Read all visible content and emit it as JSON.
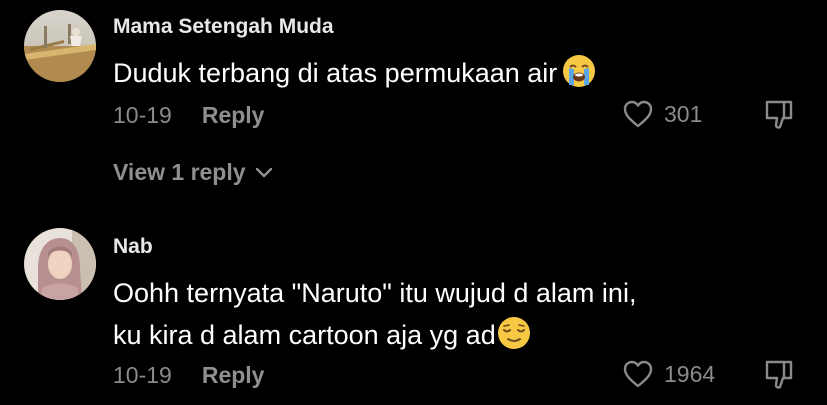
{
  "comments": [
    {
      "username": "Mama Setengah Muda",
      "text_lines": [
        "Duduk terbang di atas permukaan air"
      ],
      "emoji": "loudly-crying-face",
      "date": "10-19",
      "reply_label": "Reply",
      "like_count": "301",
      "view_replies_label": "View 1 reply",
      "avatar": "outdoor-photo-avatar"
    },
    {
      "username": "Nab",
      "text_lines": [
        "Oohh ternyata \"Naruto\" itu wujud d alam ini,",
        "ku kira d alam cartoon aja yg ad"
      ],
      "emoji": "relieved-face",
      "date": "10-19",
      "reply_label": "Reply",
      "like_count": "1964",
      "avatar": "hijab-person-avatar"
    }
  ],
  "colors": {
    "background": "#000000",
    "primary_text": "#ffffff",
    "secondary_text": "#8a8a8a"
  },
  "icons": {
    "like": "heart-outline-icon",
    "dislike": "thumbs-down-icon",
    "expand": "chevron-down-icon"
  }
}
